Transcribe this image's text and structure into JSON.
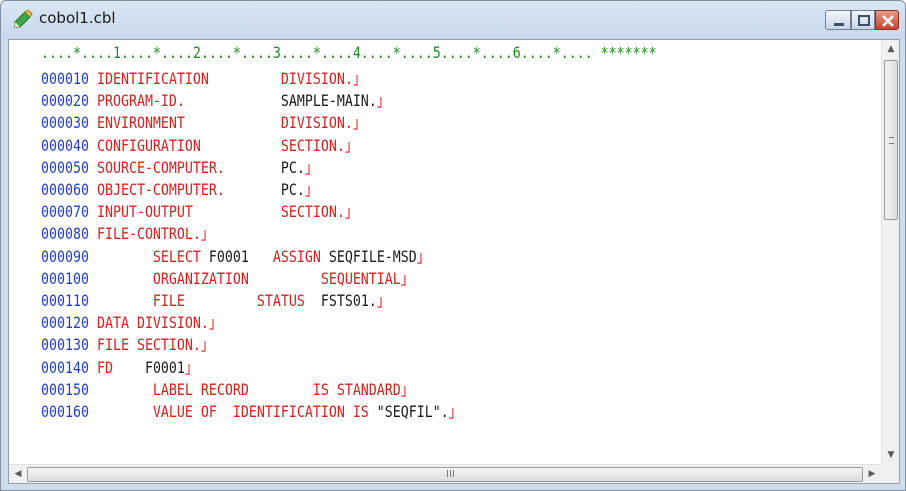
{
  "window": {
    "title": "cobol1.cbl",
    "icon": "pencil-edit-icon",
    "controls": {
      "minimize": "minimize-icon",
      "maximize": "maximize-icon",
      "close": "close-icon"
    }
  },
  "editor": {
    "ruler": "....*....1....*....2....*....3....*....4....*....5....*....6....*.... *******",
    "lines": [
      {
        "num": "000010",
        "segs": [
          {
            "c": "kw",
            "t": " IDENTIFICATION         "
          },
          {
            "c": "kw",
            "t": "DIVISION."
          },
          {
            "c": "nl",
            "t": "」"
          }
        ]
      },
      {
        "num": "000020",
        "segs": [
          {
            "c": "kw",
            "t": " PROGRAM-ID.            "
          },
          {
            "c": "tx",
            "t": "SAMPLE-MAIN."
          },
          {
            "c": "nl",
            "t": "」"
          }
        ]
      },
      {
        "num": "000030",
        "segs": [
          {
            "c": "kw",
            "t": " ENVIRONMENT            "
          },
          {
            "c": "kw",
            "t": "DIVISION."
          },
          {
            "c": "nl",
            "t": "」"
          }
        ]
      },
      {
        "num": "000040",
        "segs": [
          {
            "c": "kw",
            "t": " CONFIGURATION          "
          },
          {
            "c": "kw",
            "t": "SECTION."
          },
          {
            "c": "nl",
            "t": "」"
          }
        ]
      },
      {
        "num": "000050",
        "segs": [
          {
            "c": "kw",
            "t": " SOURCE-COMPUTER.       "
          },
          {
            "c": "tx",
            "t": "PC."
          },
          {
            "c": "nl",
            "t": "」"
          }
        ]
      },
      {
        "num": "000060",
        "segs": [
          {
            "c": "kw",
            "t": " OBJECT-COMPUTER.       "
          },
          {
            "c": "tx",
            "t": "PC."
          },
          {
            "c": "nl",
            "t": "」"
          }
        ]
      },
      {
        "num": "000070",
        "segs": [
          {
            "c": "kw",
            "t": " INPUT-OUTPUT           "
          },
          {
            "c": "kw",
            "t": "SECTION."
          },
          {
            "c": "nl",
            "t": "」"
          }
        ]
      },
      {
        "num": "000080",
        "segs": [
          {
            "c": "kw",
            "t": " FILE-CONTROL."
          },
          {
            "c": "nl",
            "t": "」"
          }
        ]
      },
      {
        "num": "000090",
        "segs": [
          {
            "c": "kw",
            "t": "        SELECT "
          },
          {
            "c": "tx",
            "t": "F0001   "
          },
          {
            "c": "kw",
            "t": "ASSIGN "
          },
          {
            "c": "tx",
            "t": "SEQFILE-MSD"
          },
          {
            "c": "nl",
            "t": "」"
          }
        ]
      },
      {
        "num": "000100",
        "segs": [
          {
            "c": "kw",
            "t": "        ORGANIZATION         SEQUENTIAL"
          },
          {
            "c": "nl",
            "t": "」"
          }
        ]
      },
      {
        "num": "000110",
        "segs": [
          {
            "c": "kw",
            "t": "        FILE         STATUS  "
          },
          {
            "c": "tx",
            "t": "FSTS01."
          },
          {
            "c": "nl",
            "t": "」"
          }
        ]
      },
      {
        "num": "000120",
        "segs": [
          {
            "c": "kw",
            "t": " DATA DIVISION."
          },
          {
            "c": "nl",
            "t": "」"
          }
        ]
      },
      {
        "num": "000130",
        "segs": [
          {
            "c": "kw",
            "t": " FILE SECTION."
          },
          {
            "c": "nl",
            "t": "」"
          }
        ]
      },
      {
        "num": "000140",
        "segs": [
          {
            "c": "kw",
            "t": " FD    "
          },
          {
            "c": "tx",
            "t": "F0001"
          },
          {
            "c": "nl",
            "t": "」"
          }
        ]
      },
      {
        "num": "000150",
        "segs": [
          {
            "c": "kw",
            "t": "        LABEL RECORD        IS STANDARD"
          },
          {
            "c": "nl",
            "t": "」"
          }
        ]
      },
      {
        "num": "000160",
        "segs": [
          {
            "c": "kw",
            "t": "        VALUE OF  IDENTIFICATION IS "
          },
          {
            "c": "tx",
            "t": "\"SEQFIL\"."
          },
          {
            "c": "nl",
            "t": "」"
          }
        ]
      }
    ]
  },
  "scrollbars": {
    "vertical_grip": "≡",
    "horizontal_grip": "III"
  },
  "colors": {
    "line_number": "#1f3fd0",
    "keyword": "#d8201e",
    "text": "#1a1a1a",
    "ruler": "#1e8c1e"
  }
}
